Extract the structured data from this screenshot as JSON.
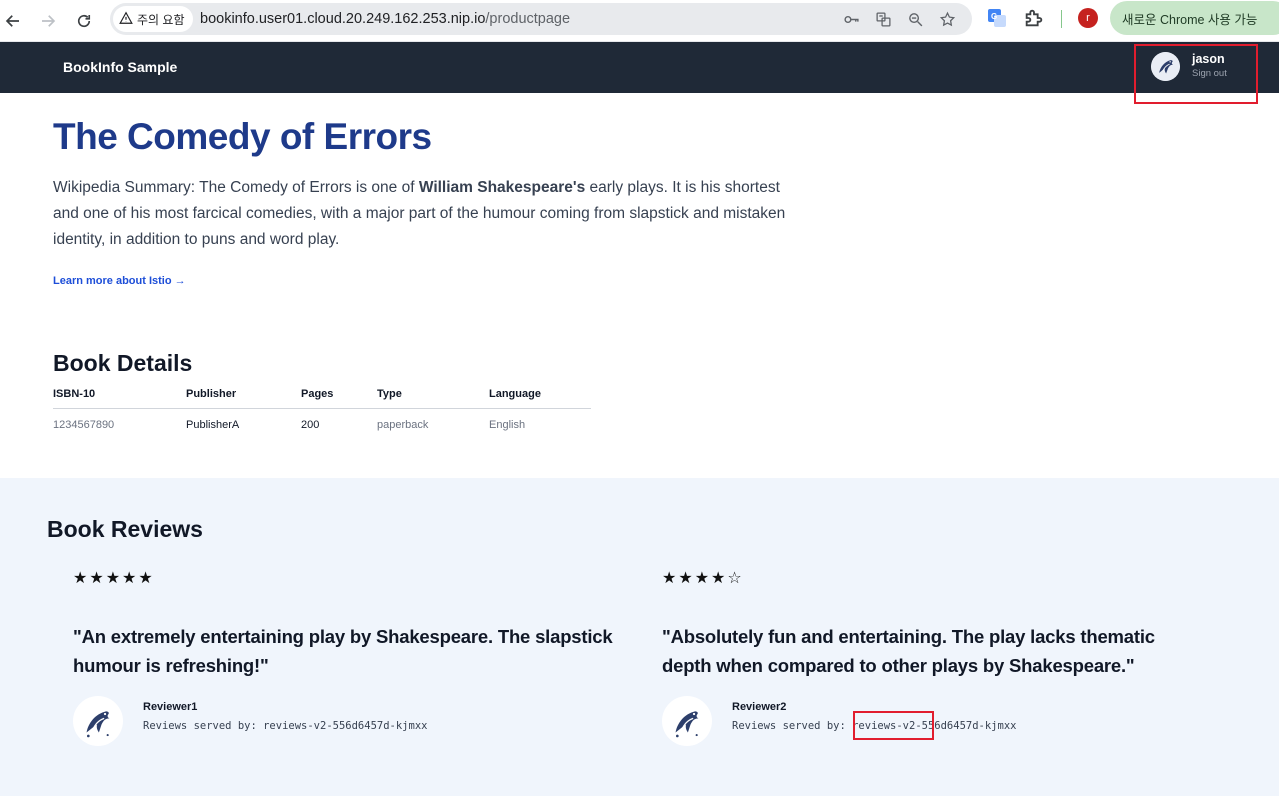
{
  "browser": {
    "security_chip": "주의 요함",
    "url_host": "bookinfo.user01.cloud.20.249.162.253.nip.io",
    "url_path": "/productpage",
    "profile_initial": "r",
    "update_label": "새로운 Chrome 사용 가능"
  },
  "navbar": {
    "brand": "BookInfo Sample",
    "user_name": "jason",
    "sign_out": "Sign out"
  },
  "product": {
    "title": "The Comedy of Errors",
    "summary_prefix": "Wikipedia Summary: The Comedy of Errors is one of ",
    "summary_bold": "William Shakespeare's",
    "summary_suffix": " early plays. It is his shortest and one of his most farcical comedies, with a major part of the humour coming from slapstick and mistaken identity, in addition to puns and word play.",
    "learn_more": "Learn more about Istio →"
  },
  "details": {
    "heading": "Book Details",
    "columns": [
      "ISBN-10",
      "Publisher",
      "Pages",
      "Type",
      "Language"
    ],
    "row": [
      "1234567890",
      "PublisherA",
      "200",
      "paperback",
      "English"
    ]
  },
  "reviews": {
    "heading": "Book Reviews",
    "items": [
      {
        "rating": 5,
        "max_rating": 5,
        "quote": "\"An extremely entertaining play by Shakespeare. The slapstick humour is refreshing!\"",
        "reviewer": "Reviewer1",
        "served_by": "Reviews served by: reviews-v2-556d6457d-kjmxx"
      },
      {
        "rating": 4,
        "max_rating": 5,
        "quote": "\"Absolutely fun and entertaining. The play lacks thematic depth when compared to other plays by Shakespeare.\"",
        "reviewer": "Reviewer2",
        "served_by": "Reviews served by: reviews-v2-556d6457d-kjmxx"
      }
    ]
  },
  "colors": {
    "navbar_bg": "#1f2937",
    "title": "#1e3a8a",
    "link": "#1d4ed8",
    "reviews_bg": "#f0f5fc",
    "highlight": "#e11d2e"
  }
}
